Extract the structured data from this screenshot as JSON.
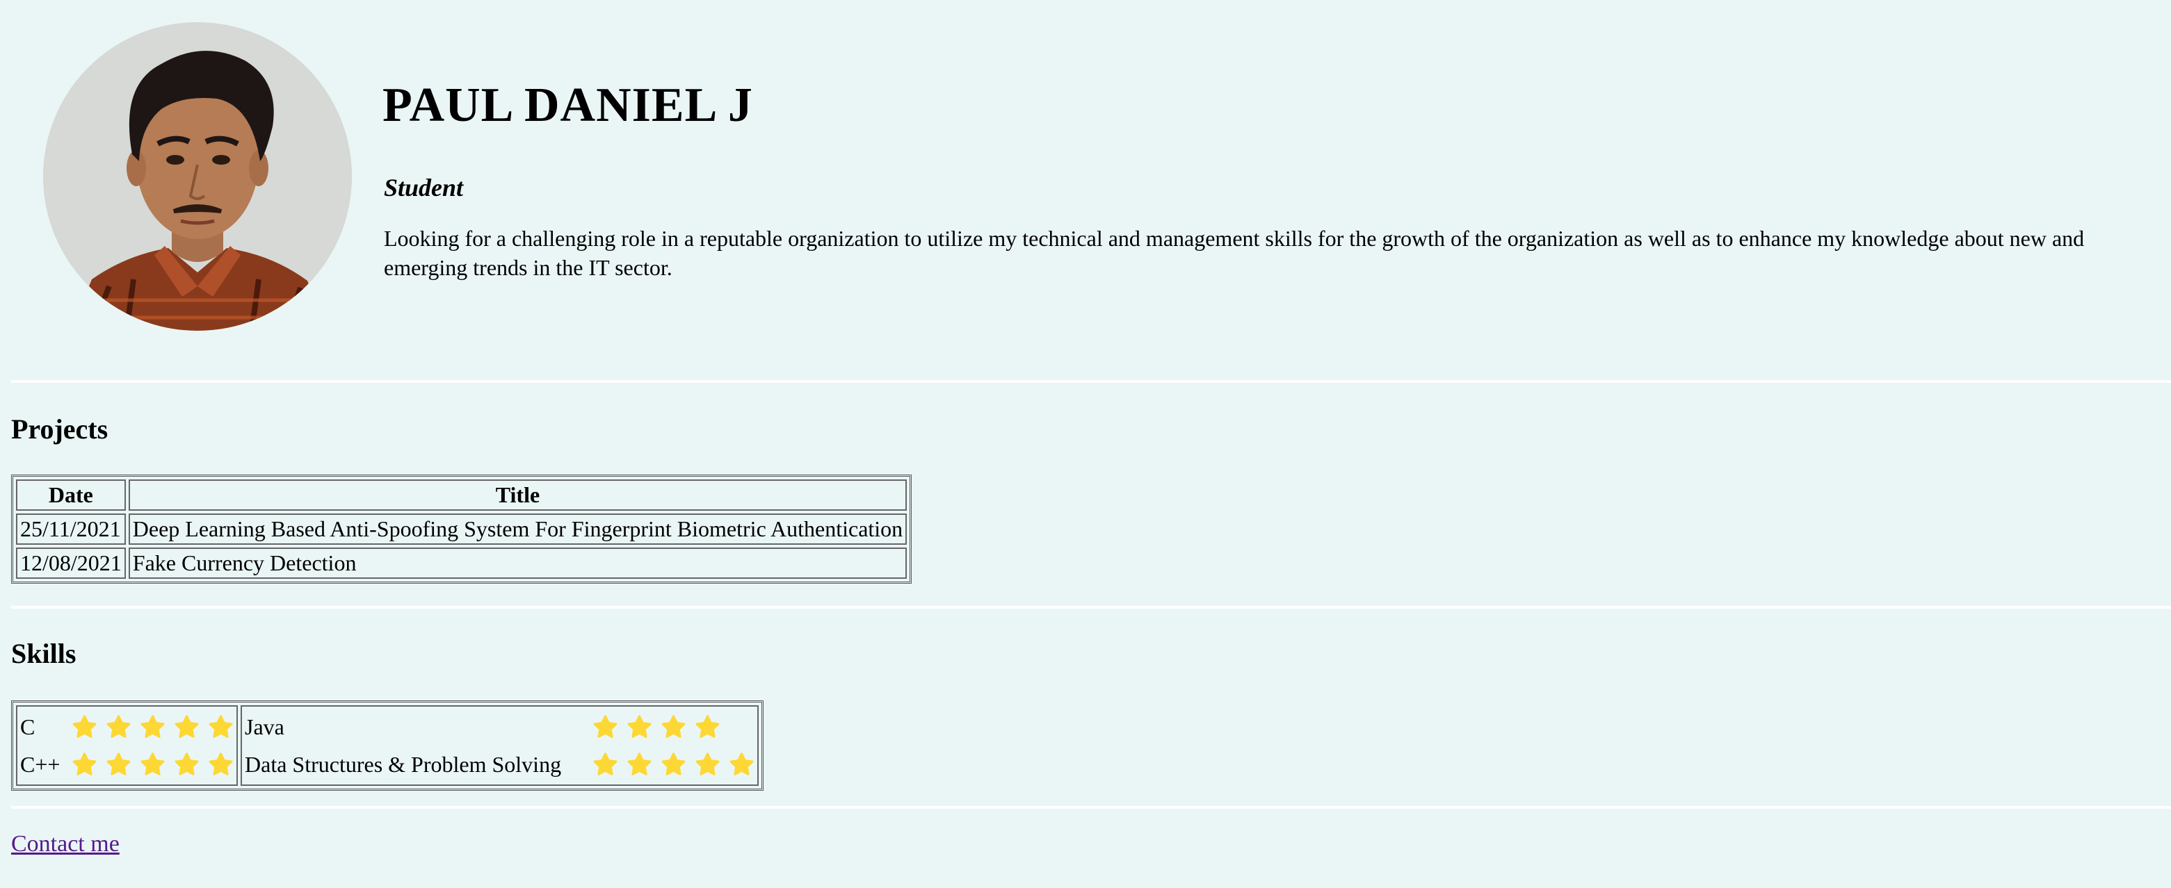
{
  "profile": {
    "name": "PAUL DANIEL J",
    "role": "Student",
    "summary": "Looking for a challenging role in a reputable organization to utilize my technical and management skills for the growth of the organization as well as to enhance my knowledge about new and emerging trends in the IT sector."
  },
  "projects": {
    "heading": "Projects",
    "columns": [
      "Date",
      "Title"
    ],
    "rows": [
      {
        "date": "25/11/2021",
        "title": "Deep Learning Based Anti-Spoofing System For Fingerprint Biometric Authentication"
      },
      {
        "date": "12/08/2021",
        "title": "Fake Currency Detection"
      }
    ]
  },
  "skills": {
    "heading": "Skills",
    "star_color": "#fdd835",
    "left": [
      {
        "name": "C",
        "rating": 5
      },
      {
        "name": "C++",
        "rating": 5
      }
    ],
    "right": [
      {
        "name": "Java",
        "rating": 4
      },
      {
        "name": "Data Structures & Problem Solving",
        "rating": 5
      }
    ]
  },
  "contact": {
    "label": "Contact me"
  },
  "theme": {
    "background": "#eaf6f5",
    "link_color": "#551a8b"
  },
  "icons": {
    "star": "star-icon",
    "avatar": "profile-photo"
  }
}
